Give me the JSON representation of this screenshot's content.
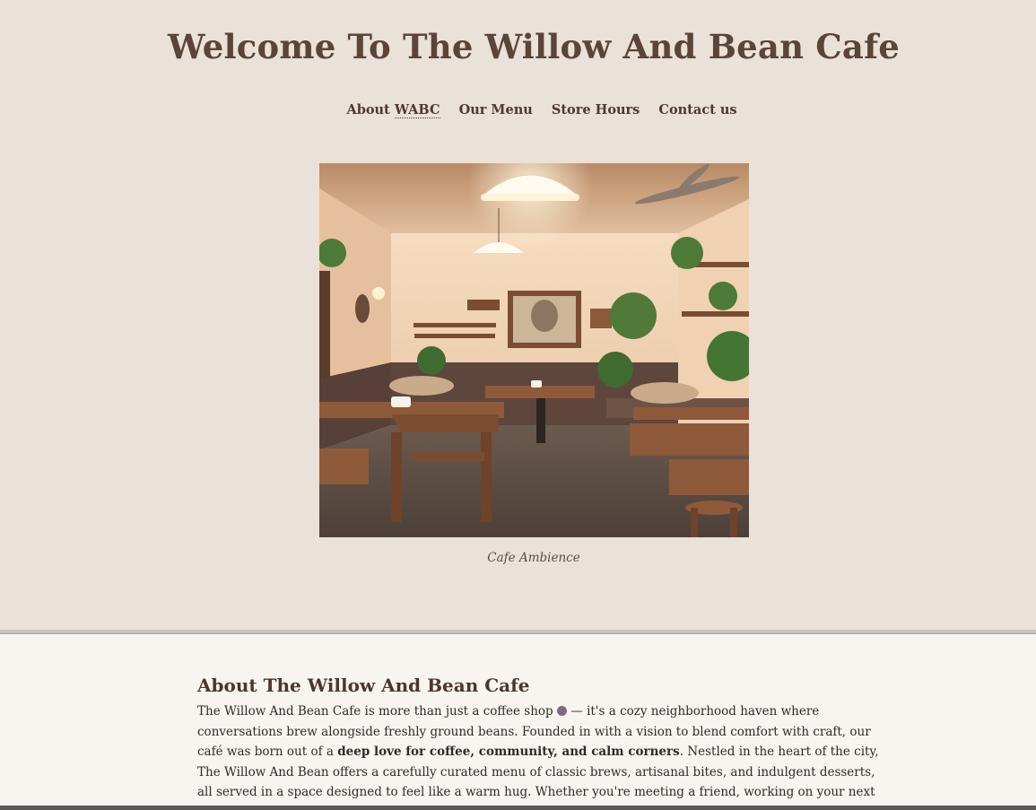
{
  "header": {
    "title": "Welcome To The Willow And Bean Cafe"
  },
  "nav": {
    "about_prefix": "About ",
    "about_abbr": "WABC",
    "menu": "Our Menu",
    "hours": "Store Hours",
    "contact": "Contact us"
  },
  "hero": {
    "image_alt": "Cafe interior",
    "caption": "Cafe Ambience"
  },
  "about": {
    "heading": "About The Willow And Bean Cafe",
    "p1": "The Willow And Bean Cafe is more than just a coffee shop ",
    "p2": " — it's a cozy neighborhood haven where conversations brew alongside freshly ground beans. Founded in with a vision to blend comfort with craft, our café was born out of a ",
    "bold": "deep love for coffee, community, and calm corners",
    "p3": ". Nestled in the heart of the city, The Willow And Bean offers a carefully curated menu of classic brews, artisanal bites, and indulgent desserts, all served in a space designed to feel like a warm hug. Whether you're meeting a friend, working on your next big idea, or simply taking a moment for yourself, our café invites you to slow"
  },
  "colors": {
    "hero_bg": "#eae1d8",
    "page_bg": "#f8f5f1",
    "title": "#5b4438",
    "nav_text": "#4d392f"
  }
}
